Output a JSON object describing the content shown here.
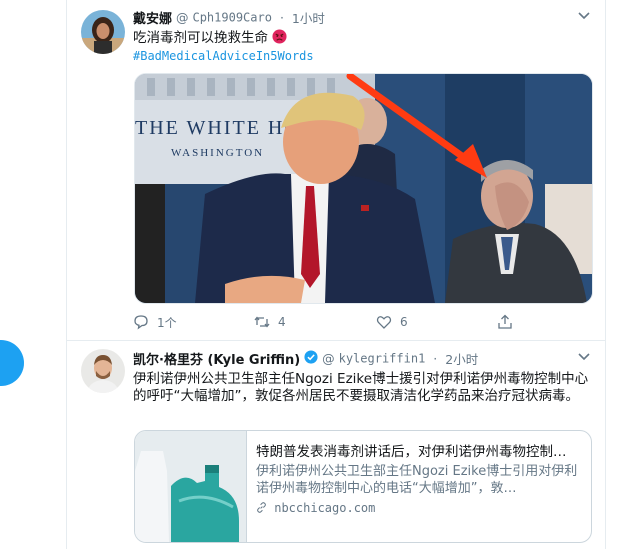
{
  "tweets": [
    {
      "name": "戴安娜",
      "at": "@",
      "handle": "Cph1909Caro",
      "dot": "·",
      "time": "1小时",
      "text": "吃消毒剂可以挽救生命",
      "emoji": "angry-face-emoji",
      "hashtag": "#BadMedicalAdviceIn5Words",
      "media_text": "THE WHITE HO",
      "media_subtext": "WASHINGTON",
      "actions": {
        "reply": "1个",
        "retweet": "4",
        "like": "6"
      }
    },
    {
      "name": "凯尔·格里芬 (Kyle Griffin)",
      "verified": true,
      "at": "@",
      "handle": "kylegriffin1",
      "dot": "·",
      "time": "2小时",
      "text": "伊利诺伊州公共卫生部主任Ngozi Ezike博士援引对伊利诺伊州毒物控制中心的呼吁“大幅增加”，敦促各州居民不要摄取清洁化学药品来治疗冠状病毒。",
      "card": {
        "title": "特朗普发表消毒剂讲话后，对伊利诺伊州毒物控制…",
        "description": "伊利诺伊州公共卫生部主任Ngozi Ezike博士引用对伊利诺伊州毒物控制中心的电话“大幅增加”，敦…",
        "domain": "nbcchicago.com"
      }
    }
  ],
  "colors": {
    "accent": "#1da1f2",
    "link": "#1b95e0",
    "muted": "#657786",
    "verified": "#1da1f2"
  }
}
